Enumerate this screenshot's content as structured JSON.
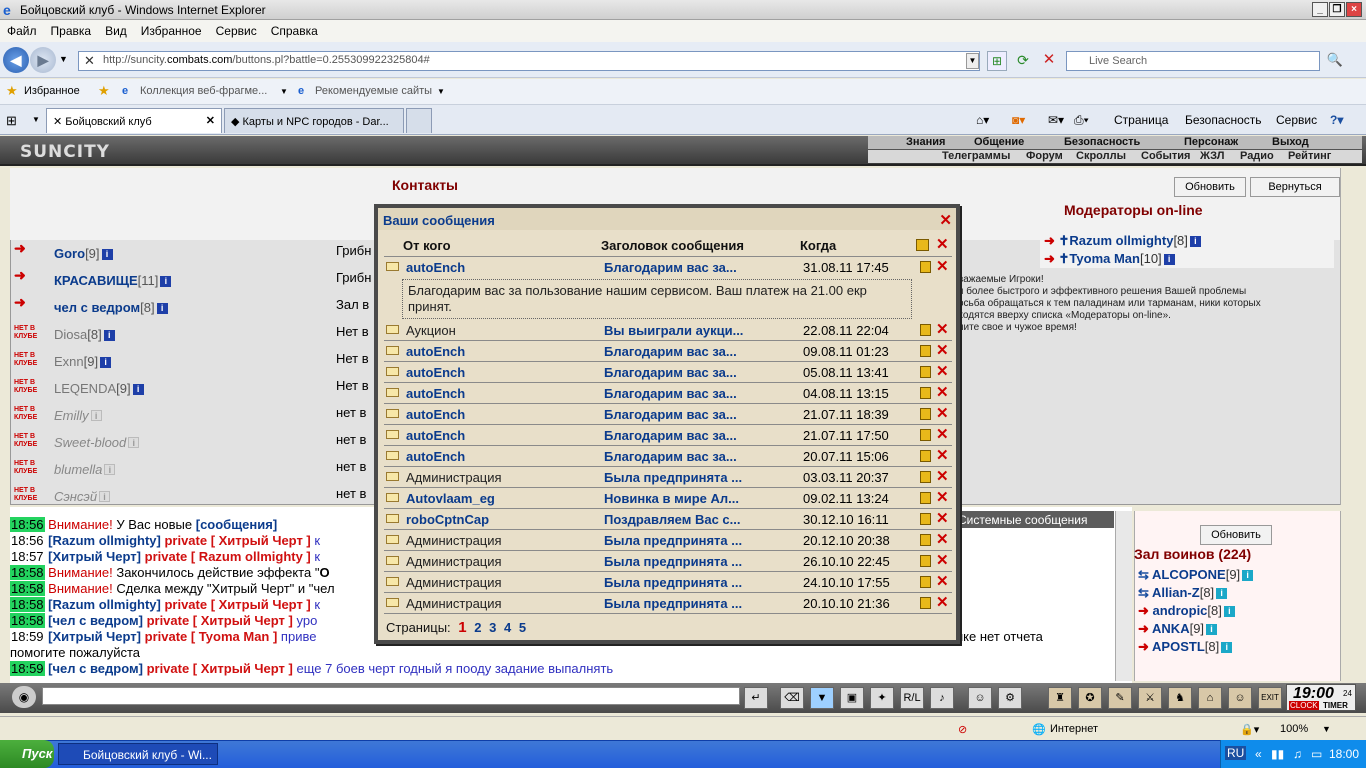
{
  "window": {
    "title": "Бойцовский клуб - Windows Internet Explorer"
  },
  "menu": [
    "Файл",
    "Правка",
    "Вид",
    "Избранное",
    "Сервис",
    "Справка"
  ],
  "address": {
    "prefix": "http://suncity.",
    "host": "combats.com",
    "path": "/buttons.pl?battle=0.255309922325804#"
  },
  "search": {
    "placeholder": "Live Search"
  },
  "favorites": {
    "label": "Избранное",
    "item1": "Коллекция веб-фрагме...",
    "item2": "Рекомендуемые сайты"
  },
  "tabs": [
    "Бойцовский клуб",
    "Карты и NPC городов - Dar..."
  ],
  "commands": {
    "page": "Страница",
    "security": "Безопасность",
    "service": "Сервис"
  },
  "game": {
    "logo": "SUNCITY",
    "nav1": [
      "Знания",
      "Общение",
      "Безопасность",
      "Персонаж",
      "Выход"
    ],
    "nav2": [
      "Телеграммы",
      "Форум",
      "Скроллы",
      "События",
      "ЖЗЛ",
      "Радио",
      "Рейтинг"
    ]
  },
  "contacts": {
    "title": "Контакты",
    "refresh": "Обновить",
    "back": "Вернуться",
    "mod_title": "Модераторы on-line",
    "offline_icon": "НЕТ В КЛУБЕ",
    "rows": [
      {
        "name": "Goro",
        "lvl": "[9]",
        "loc": "Грибн"
      },
      {
        "name": "КРАСАВИЩЕ",
        "lvl": "[11]",
        "loc": "Грибн"
      },
      {
        "name": "чел с ведром",
        "lvl": "[8]",
        "loc": "Зал в"
      },
      {
        "name": "Diosa",
        "lvl": "[8]",
        "loc": "Нет в"
      },
      {
        "name": "Exnn",
        "lvl": "[9]",
        "loc": "Нет в"
      },
      {
        "name": "LEQENDA",
        "lvl": "[9]",
        "loc": "Нет в"
      },
      {
        "name": "Emilly",
        "lvl": "",
        "loc": "нет в"
      },
      {
        "name": "Sweet-blood",
        "lvl": "",
        "loc": "нет в"
      },
      {
        "name": "blumella",
        "lvl": "",
        "loc": "нет в"
      },
      {
        "name": "Сэнсэй",
        "lvl": "",
        "loc": "нет в"
      }
    ],
    "mods": [
      {
        "name": "Razum ollmighty",
        "lvl": "[8]"
      },
      {
        "name": "Tyoma Man",
        "lvl": "[10]"
      }
    ],
    "rules": [
      "важаемые Игроки!",
      "я более быстрого и эффективного решения Вашей проблемы",
      "осьба обращаться к тем паладинам или тарманам, ники которых",
      "ходятся вверху списка «Модераторы on-line».",
      "ните свое и чужое время!"
    ]
  },
  "dialog": {
    "title": "Ваши сообщения",
    "cols": {
      "from": "От кого",
      "subject": "Заголовок сообщения",
      "when": "Когда"
    },
    "body": "Благодарим вас за пользование нашим сервисом. Ваш платеж на 21.00 екр принят.",
    "messages": [
      {
        "from": "autoEnch",
        "subject": "Благодарим вас за...",
        "when": "31.08.11 17:45"
      },
      {
        "from": "Аукцион",
        "subject": "Вы выиграли аукци...",
        "when": "22.08.11 22:04"
      },
      {
        "from": "autoEnch",
        "subject": "Благодарим вас за...",
        "when": "09.08.11 01:23"
      },
      {
        "from": "autoEnch",
        "subject": "Благодарим вас за...",
        "when": "05.08.11 13:41"
      },
      {
        "from": "autoEnch",
        "subject": "Благодарим вас за...",
        "when": "04.08.11 13:15"
      },
      {
        "from": "autoEnch",
        "subject": "Благодарим вас за...",
        "when": "21.07.11 18:39"
      },
      {
        "from": "autoEnch",
        "subject": "Благодарим вас за...",
        "when": "21.07.11 17:50"
      },
      {
        "from": "autoEnch",
        "subject": "Благодарим вас за...",
        "when": "20.07.11 15:06"
      },
      {
        "from": "Администрация",
        "subject": "Была предпринята ...",
        "when": "03.03.11 20:37"
      },
      {
        "from": "Autovlaam_eg",
        "subject": "Новинка в мире Ал...",
        "when": "09.02.11 13:24"
      },
      {
        "from": "roboCptnCap",
        "subject": "Поздравляем Вас с...",
        "when": "30.12.10 16:11"
      },
      {
        "from": "Администрация",
        "subject": "Была предпринята ...",
        "when": "20.12.10 20:38"
      },
      {
        "from": "Администрация",
        "subject": "Была предпринята ...",
        "when": "26.10.10 22:45"
      },
      {
        "from": "Администрация",
        "subject": "Была предпринята ...",
        "when": "24.10.10 17:55"
      },
      {
        "from": "Администрация",
        "subject": "Была предпринята ...",
        "when": "20.10.10 21:36"
      }
    ],
    "pages_label": "Страницы:",
    "pages": [
      "1",
      "2",
      "3",
      "4",
      "5"
    ]
  },
  "chat": {
    "lines": [
      {
        "t": "18:56",
        "a": "Внимание!",
        "b": " У Вас новые ",
        "c": "[сообщения]"
      },
      {
        "t": "18:56",
        "a": "[Razum ollmighty]",
        "b": " private [ Хитрый Черт ]",
        "c": " к"
      },
      {
        "t": "18:57",
        "a": "[Хитрый Черт]",
        "b": " private [ Razum ollmighty ]",
        "c": " к"
      },
      {
        "t": "18:58",
        "a": "Внимание!",
        "b": " Закончилось действие эффекта \"",
        "c": "О"
      },
      {
        "t": "18:58",
        "a": "Внимание!",
        "b": " Сделка между \"Хитрый Черт\" и \"чел",
        "c": ""
      },
      {
        "t": "18:58",
        "a": "[Razum ollmighty]",
        "b": " private [ Хитрый Черт ]",
        "c": " к"
      },
      {
        "t": "18:58",
        "a": "[чел с ведром]",
        "b": " private [ Хитрый Черт ]",
        "c": " уро"
      },
      {
        "t": "18:59",
        "a": "[Хитрый Черт]",
        "b": " private [ Tyoma Man ]",
        "c": " приве"
      },
      {
        "t": "18:59",
        "a": "[чел с ведром]",
        "b": " private [ Хитрый Черт ]",
        "c": " еще 7 боев черт годный я пооду задание выпалнять"
      }
    ],
    "cont1": "нке нет отчета",
    "cont2": "помогите пожалуйста",
    "sys_tab": "Системные сообщения"
  },
  "hall": {
    "refresh": "Обновить",
    "title": "Зал воинов (224)",
    "warriors": [
      {
        "name": "ALCOPONE",
        "lvl": "[9]"
      },
      {
        "name": "Allian-Z",
        "lvl": "[8]"
      },
      {
        "name": "andropic",
        "lvl": "[8]"
      },
      {
        "name": "ANKA",
        "lvl": "[9]"
      },
      {
        "name": "APOSTL",
        "lvl": "[8]"
      }
    ]
  },
  "clock": {
    "time": "19:00",
    "sec": "24",
    "label1": "CLOCK",
    "label2": "TIMER"
  },
  "status": {
    "zone": "Интернет",
    "zoom": "100%"
  },
  "taskbar": {
    "start": "Пуск",
    "task": "Бойцовский клуб - Wi...",
    "lang": "RU",
    "time": "18:00"
  }
}
